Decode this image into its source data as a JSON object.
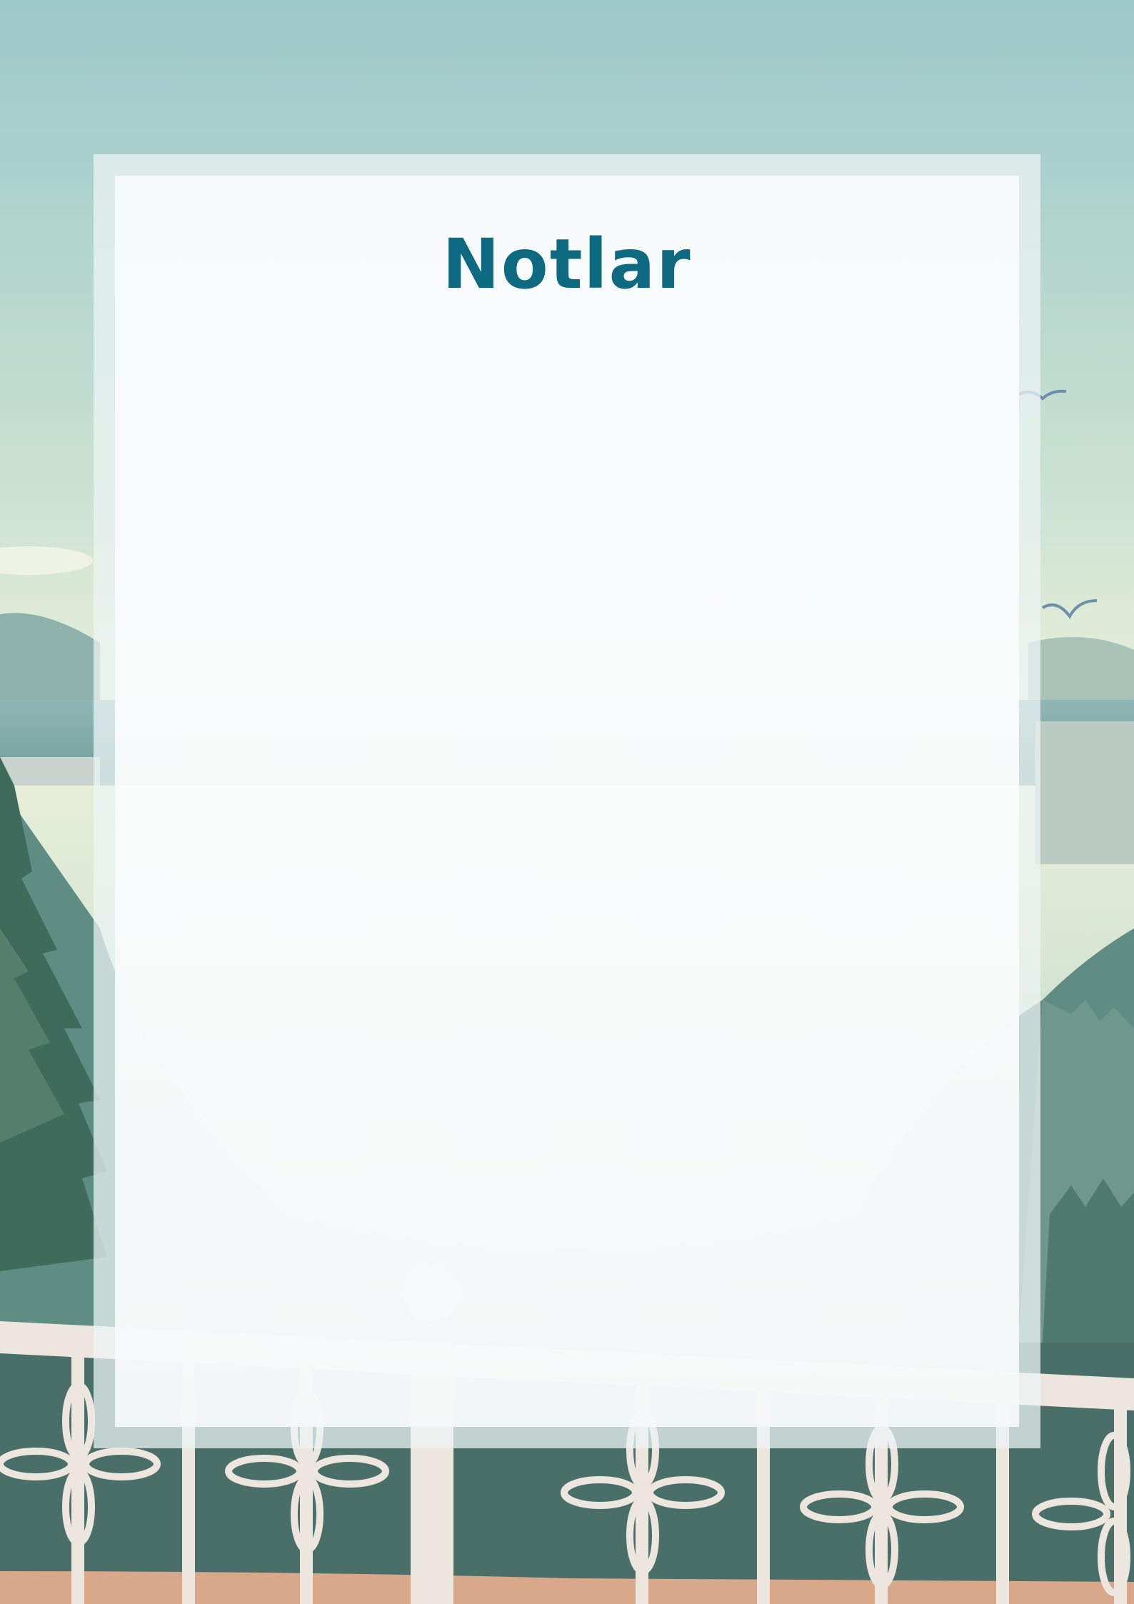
{
  "page": {
    "title": "Notlar",
    "colors": {
      "title": "#0e6a80",
      "sky": "#9fc9c8",
      "card": "#f6f9fa",
      "railing": "#ece6df"
    },
    "icons": [
      "mountain-landscape-illustration",
      "balcony-railing-illustration",
      "bird-icon"
    ]
  }
}
